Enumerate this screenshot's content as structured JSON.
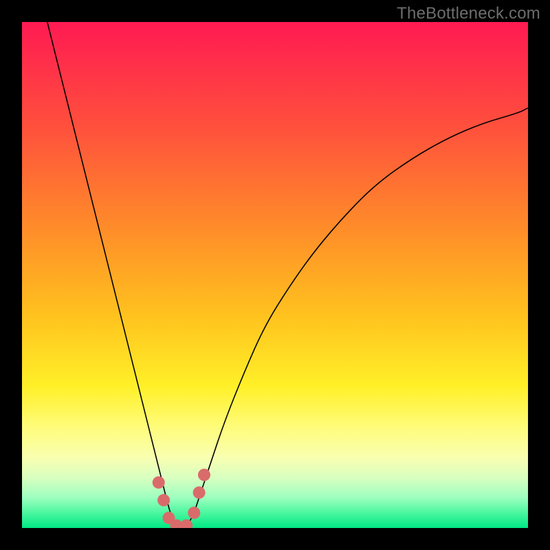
{
  "watermark": "TheBottleneck.com",
  "chart_data": {
    "type": "line",
    "title": "",
    "xlabel": "",
    "ylabel": "",
    "xlim": [
      0,
      100
    ],
    "ylim": [
      0,
      100
    ],
    "background_gradient": {
      "stops": [
        {
          "offset": 0.0,
          "color": "#ff1a52"
        },
        {
          "offset": 0.2,
          "color": "#ff4e3d"
        },
        {
          "offset": 0.4,
          "color": "#ff8a2a"
        },
        {
          "offset": 0.58,
          "color": "#ffc21e"
        },
        {
          "offset": 0.72,
          "color": "#fff028"
        },
        {
          "offset": 0.8,
          "color": "#fffc7a"
        },
        {
          "offset": 0.86,
          "color": "#f9ffb0"
        },
        {
          "offset": 0.9,
          "color": "#d9ffc0"
        },
        {
          "offset": 0.94,
          "color": "#9dffbf"
        },
        {
          "offset": 0.97,
          "color": "#4bf7a0"
        },
        {
          "offset": 1.0,
          "color": "#00e884"
        }
      ]
    },
    "series": [
      {
        "name": "bottleneck-curve",
        "color": "#000000",
        "stroke_width": 1.6,
        "x": [
          5,
          7,
          9,
          11,
          13,
          15,
          17,
          19,
          21,
          23,
          25,
          27,
          28,
          29,
          30,
          31,
          32,
          33,
          34,
          35,
          37,
          40,
          44,
          48,
          53,
          58,
          64,
          70,
          77,
          84,
          91,
          98,
          100
        ],
        "y": [
          100,
          92,
          84,
          76,
          68,
          60,
          52,
          44,
          36,
          28,
          20,
          12,
          8,
          4,
          1,
          0,
          0,
          1,
          3,
          6,
          12,
          21,
          31,
          40,
          48,
          55,
          62,
          68,
          73,
          77,
          80,
          82,
          83
        ]
      }
    ],
    "markers": {
      "color": "#da6b6b",
      "radius": 9,
      "points": [
        {
          "x": 27.0,
          "y": 9.0
        },
        {
          "x": 28.0,
          "y": 5.5
        },
        {
          "x": 29.0,
          "y": 2.0
        },
        {
          "x": 30.5,
          "y": 0.5
        },
        {
          "x": 32.5,
          "y": 0.5
        },
        {
          "x": 34.0,
          "y": 3.0
        },
        {
          "x": 35.0,
          "y": 7.0
        },
        {
          "x": 36.0,
          "y": 10.5
        }
      ]
    }
  }
}
